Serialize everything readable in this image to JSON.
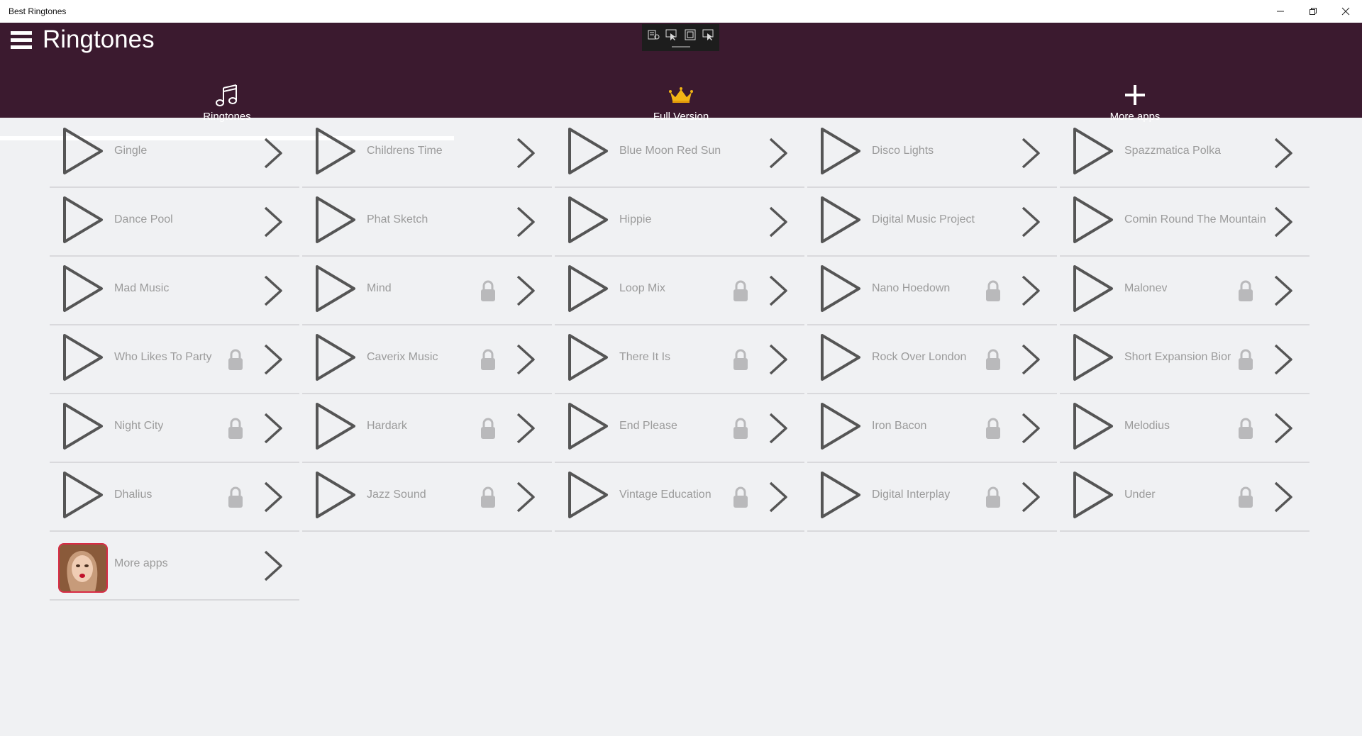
{
  "window": {
    "title": "Best Ringtones",
    "controls": [
      "minimize",
      "restore",
      "close"
    ]
  },
  "header": {
    "menu_icon": "hamburger-icon",
    "title": "Ringtones",
    "background": "#3b1a2f"
  },
  "tabs": [
    {
      "label": "Ringtones",
      "icon": "music-note-icon",
      "active": true
    },
    {
      "label": "Full Version",
      "icon": "crown-icon",
      "active": false
    },
    {
      "label": "More apps",
      "icon": "plus-icon",
      "active": false
    }
  ],
  "ringtones": [
    {
      "name": "Gingle",
      "locked": false
    },
    {
      "name": "Childrens Time",
      "locked": false
    },
    {
      "name": "Blue Moon Red Sun",
      "locked": false
    },
    {
      "name": "Disco Lights",
      "locked": false
    },
    {
      "name": "Spazzmatica Polka",
      "locked": false
    },
    {
      "name": "Dance Pool",
      "locked": false
    },
    {
      "name": "Phat Sketch",
      "locked": false
    },
    {
      "name": "Hippie",
      "locked": false
    },
    {
      "name": "Digital Music Project",
      "locked": false
    },
    {
      "name": "Comin Round The Mountain",
      "locked": false
    },
    {
      "name": "Mad Music",
      "locked": false
    },
    {
      "name": "Mind",
      "locked": true
    },
    {
      "name": "Loop Mix",
      "locked": true
    },
    {
      "name": "Nano Hoedown",
      "locked": true
    },
    {
      "name": "Malonev",
      "locked": true
    },
    {
      "name": "Who Likes To Party",
      "locked": true
    },
    {
      "name": "Caverix Music",
      "locked": true
    },
    {
      "name": "There It Is",
      "locked": true
    },
    {
      "name": "Rock Over London",
      "locked": true
    },
    {
      "name": "Short Expansion Bior",
      "locked": true
    },
    {
      "name": "Night City",
      "locked": true
    },
    {
      "name": "Hardark",
      "locked": true
    },
    {
      "name": "End Please",
      "locked": true
    },
    {
      "name": "Iron Bacon",
      "locked": true
    },
    {
      "name": "Melodius",
      "locked": true
    },
    {
      "name": "Dhalius",
      "locked": true
    },
    {
      "name": "Jazz Sound",
      "locked": true
    },
    {
      "name": "Vintage Education",
      "locked": true
    },
    {
      "name": "Digital Interplay",
      "locked": true
    },
    {
      "name": "Under",
      "locked": true
    }
  ],
  "more_apps_item": {
    "name": "More apps",
    "thumbnail": "promo-thumbnail-image"
  }
}
